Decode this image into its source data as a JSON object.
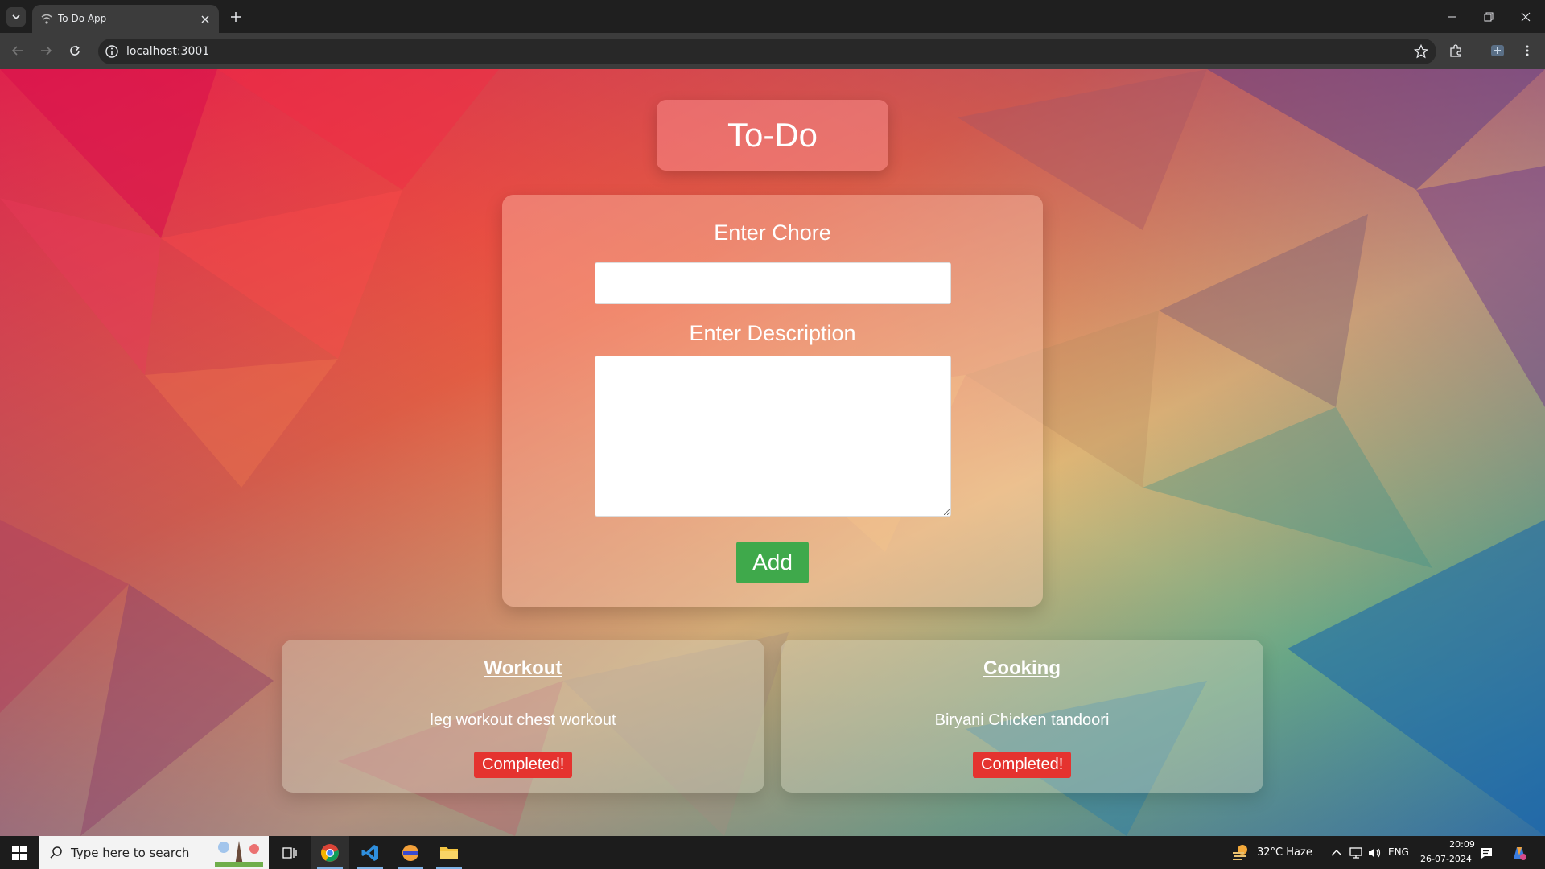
{
  "browser": {
    "tab_title": "To Do App",
    "url": "localhost:3001"
  },
  "page": {
    "title": "To-Do",
    "form": {
      "chore_label": "Enter Chore",
      "chore_value": "",
      "description_label": "Enter Description",
      "description_value": "",
      "add_label": "Add"
    },
    "todos": [
      {
        "title": "Workout",
        "description": "leg workout chest workout",
        "button": "Completed!"
      },
      {
        "title": "Cooking",
        "description": "Biryani Chicken tandoori",
        "button": "Completed!"
      }
    ],
    "colors": {
      "add_button": "#3fa94b",
      "completed_button": "#e5332f"
    }
  },
  "taskbar": {
    "search_placeholder": "Type here to search",
    "weather": "32°C  Haze",
    "language": "ENG",
    "time": "20:09",
    "date": "26-07-2024"
  }
}
